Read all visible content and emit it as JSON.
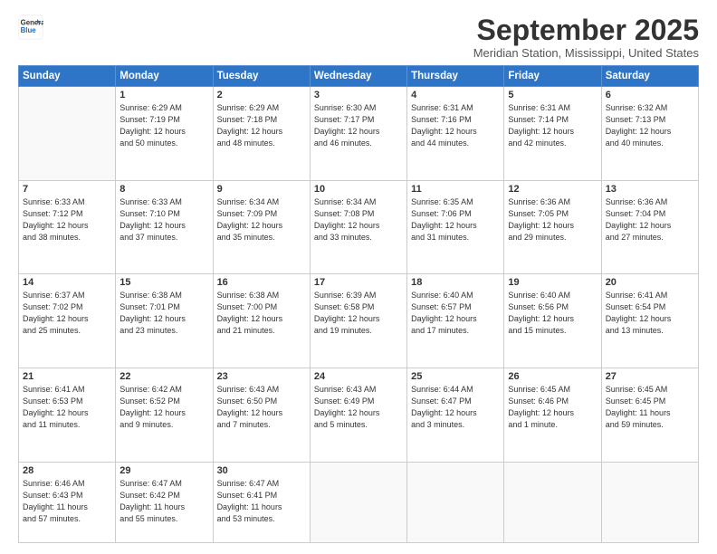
{
  "logo": {
    "line1": "General",
    "line2": "Blue"
  },
  "title": "September 2025",
  "location": "Meridian Station, Mississippi, United States",
  "weekdays": [
    "Sunday",
    "Monday",
    "Tuesday",
    "Wednesday",
    "Thursday",
    "Friday",
    "Saturday"
  ],
  "weeks": [
    [
      {
        "day": "",
        "info": ""
      },
      {
        "day": "1",
        "info": "Sunrise: 6:29 AM\nSunset: 7:19 PM\nDaylight: 12 hours\nand 50 minutes."
      },
      {
        "day": "2",
        "info": "Sunrise: 6:29 AM\nSunset: 7:18 PM\nDaylight: 12 hours\nand 48 minutes."
      },
      {
        "day": "3",
        "info": "Sunrise: 6:30 AM\nSunset: 7:17 PM\nDaylight: 12 hours\nand 46 minutes."
      },
      {
        "day": "4",
        "info": "Sunrise: 6:31 AM\nSunset: 7:16 PM\nDaylight: 12 hours\nand 44 minutes."
      },
      {
        "day": "5",
        "info": "Sunrise: 6:31 AM\nSunset: 7:14 PM\nDaylight: 12 hours\nand 42 minutes."
      },
      {
        "day": "6",
        "info": "Sunrise: 6:32 AM\nSunset: 7:13 PM\nDaylight: 12 hours\nand 40 minutes."
      }
    ],
    [
      {
        "day": "7",
        "info": "Sunrise: 6:33 AM\nSunset: 7:12 PM\nDaylight: 12 hours\nand 38 minutes."
      },
      {
        "day": "8",
        "info": "Sunrise: 6:33 AM\nSunset: 7:10 PM\nDaylight: 12 hours\nand 37 minutes."
      },
      {
        "day": "9",
        "info": "Sunrise: 6:34 AM\nSunset: 7:09 PM\nDaylight: 12 hours\nand 35 minutes."
      },
      {
        "day": "10",
        "info": "Sunrise: 6:34 AM\nSunset: 7:08 PM\nDaylight: 12 hours\nand 33 minutes."
      },
      {
        "day": "11",
        "info": "Sunrise: 6:35 AM\nSunset: 7:06 PM\nDaylight: 12 hours\nand 31 minutes."
      },
      {
        "day": "12",
        "info": "Sunrise: 6:36 AM\nSunset: 7:05 PM\nDaylight: 12 hours\nand 29 minutes."
      },
      {
        "day": "13",
        "info": "Sunrise: 6:36 AM\nSunset: 7:04 PM\nDaylight: 12 hours\nand 27 minutes."
      }
    ],
    [
      {
        "day": "14",
        "info": "Sunrise: 6:37 AM\nSunset: 7:02 PM\nDaylight: 12 hours\nand 25 minutes."
      },
      {
        "day": "15",
        "info": "Sunrise: 6:38 AM\nSunset: 7:01 PM\nDaylight: 12 hours\nand 23 minutes."
      },
      {
        "day": "16",
        "info": "Sunrise: 6:38 AM\nSunset: 7:00 PM\nDaylight: 12 hours\nand 21 minutes."
      },
      {
        "day": "17",
        "info": "Sunrise: 6:39 AM\nSunset: 6:58 PM\nDaylight: 12 hours\nand 19 minutes."
      },
      {
        "day": "18",
        "info": "Sunrise: 6:40 AM\nSunset: 6:57 PM\nDaylight: 12 hours\nand 17 minutes."
      },
      {
        "day": "19",
        "info": "Sunrise: 6:40 AM\nSunset: 6:56 PM\nDaylight: 12 hours\nand 15 minutes."
      },
      {
        "day": "20",
        "info": "Sunrise: 6:41 AM\nSunset: 6:54 PM\nDaylight: 12 hours\nand 13 minutes."
      }
    ],
    [
      {
        "day": "21",
        "info": "Sunrise: 6:41 AM\nSunset: 6:53 PM\nDaylight: 12 hours\nand 11 minutes."
      },
      {
        "day": "22",
        "info": "Sunrise: 6:42 AM\nSunset: 6:52 PM\nDaylight: 12 hours\nand 9 minutes."
      },
      {
        "day": "23",
        "info": "Sunrise: 6:43 AM\nSunset: 6:50 PM\nDaylight: 12 hours\nand 7 minutes."
      },
      {
        "day": "24",
        "info": "Sunrise: 6:43 AM\nSunset: 6:49 PM\nDaylight: 12 hours\nand 5 minutes."
      },
      {
        "day": "25",
        "info": "Sunrise: 6:44 AM\nSunset: 6:47 PM\nDaylight: 12 hours\nand 3 minutes."
      },
      {
        "day": "26",
        "info": "Sunrise: 6:45 AM\nSunset: 6:46 PM\nDaylight: 12 hours\nand 1 minute."
      },
      {
        "day": "27",
        "info": "Sunrise: 6:45 AM\nSunset: 6:45 PM\nDaylight: 11 hours\nand 59 minutes."
      }
    ],
    [
      {
        "day": "28",
        "info": "Sunrise: 6:46 AM\nSunset: 6:43 PM\nDaylight: 11 hours\nand 57 minutes."
      },
      {
        "day": "29",
        "info": "Sunrise: 6:47 AM\nSunset: 6:42 PM\nDaylight: 11 hours\nand 55 minutes."
      },
      {
        "day": "30",
        "info": "Sunrise: 6:47 AM\nSunset: 6:41 PM\nDaylight: 11 hours\nand 53 minutes."
      },
      {
        "day": "",
        "info": ""
      },
      {
        "day": "",
        "info": ""
      },
      {
        "day": "",
        "info": ""
      },
      {
        "day": "",
        "info": ""
      }
    ]
  ]
}
